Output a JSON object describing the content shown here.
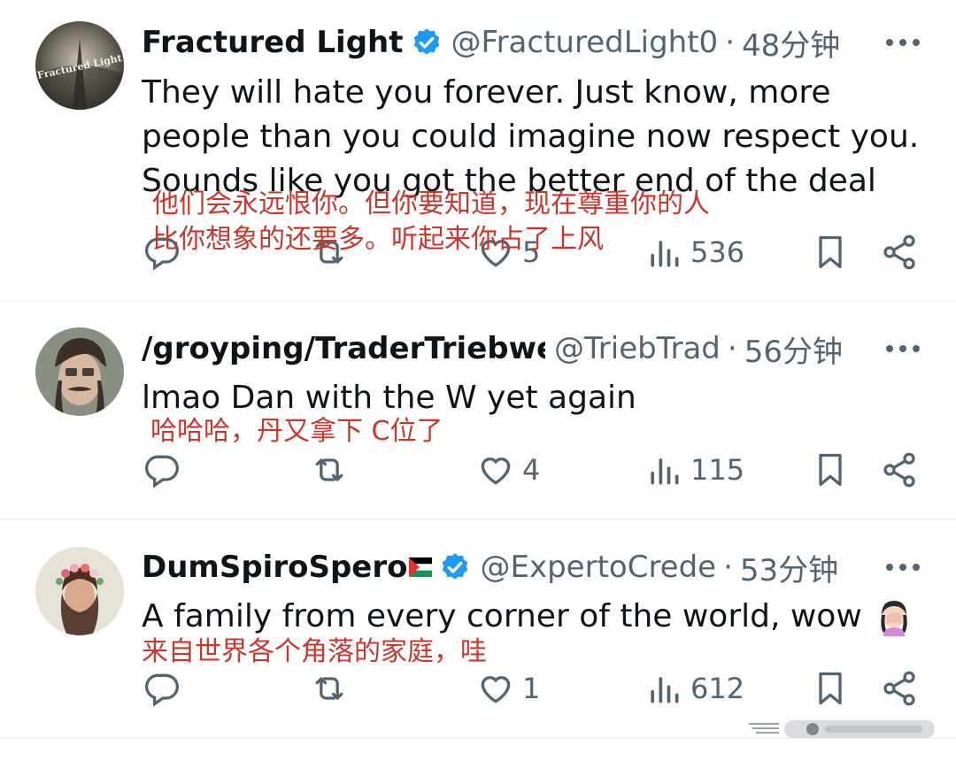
{
  "tweets": [
    {
      "display_name": "Fractured Light",
      "verified": true,
      "handle": "@FracturedLight0",
      "separator": "·",
      "time": "48分钟",
      "text": "They will hate you forever. Just know, more people than you could imagine now respect you. Sounds like you got the better end of the deal",
      "translation_lines": [
        "他们会永远恨你。但你要知道，现在尊重你的人",
        "比你想象的还要多。听起来你占了上风"
      ],
      "likes": "5",
      "views": "536",
      "avatar_text": "Fractured Light"
    },
    {
      "display_name": "/groyping/TraderTriebwe",
      "verified": false,
      "handle": "@TriebTrad",
      "separator": "·",
      "time": "56分钟",
      "text": "lmao Dan with the W yet again",
      "translation_lines": [
        "哈哈哈，丹又拿下 C位了"
      ],
      "likes": "4",
      "views": "115"
    },
    {
      "display_name": "DumSpiroSpero",
      "verified": true,
      "handle": "@ExpertoCrede",
      "separator": "·",
      "time": "53分钟",
      "text": "A family from every corner of the world, wow",
      "translation_lines": [
        "来自世界各个角落的家庭，哇"
      ],
      "likes": "1",
      "views": "612"
    }
  ],
  "colors": {
    "text": "#0f1419",
    "secondary": "#536471",
    "verified_blue": "#1d9bf0",
    "annotation_red": "#c8372d",
    "divider": "#eff3f4"
  },
  "icons": {
    "reply": "reply-icon",
    "retweet": "retweet-icon",
    "like": "heart-icon",
    "views": "views-icon",
    "bookmark": "bookmark-icon",
    "share": "share-icon",
    "more": "more-icon",
    "verified": "verified-badge-icon",
    "flag": "palestine-flag-icon"
  }
}
